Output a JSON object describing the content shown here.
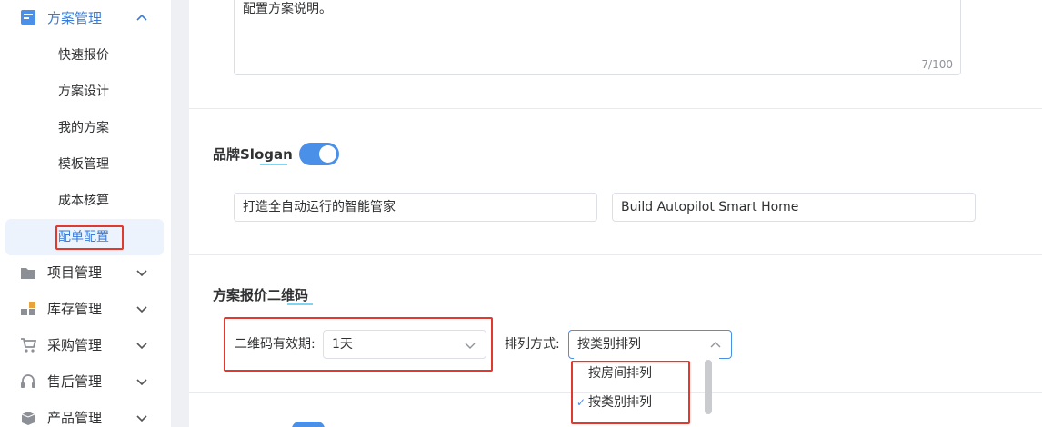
{
  "sidebar": {
    "groups": [
      {
        "label": "方案管理",
        "icon": "document-icon",
        "expanded": true
      },
      {
        "label": "项目管理",
        "icon": "folder-icon"
      },
      {
        "label": "库存管理",
        "icon": "blocks-icon"
      },
      {
        "label": "采购管理",
        "icon": "cart-icon"
      },
      {
        "label": "售后管理",
        "icon": "headset-icon"
      },
      {
        "label": "产品管理",
        "icon": "box-icon"
      }
    ],
    "sub_items": [
      "快速报价",
      "方案设计",
      "我的方案",
      "模板管理",
      "成本核算",
      "配单配置"
    ],
    "active_sub": "配单配置"
  },
  "description": {
    "value": "配置方案说明。",
    "count": "7/100"
  },
  "slogan": {
    "title": "品牌Slogan",
    "enabled": true,
    "cn_value": "打造全自动运行的智能管家",
    "en_value": "Build Autopilot Smart Home"
  },
  "qrcode": {
    "title": "方案报价二维码",
    "validity_label": "二维码有效期:",
    "validity_value": "1天",
    "sort_label": "排列方式:",
    "sort_value": "按类别排列",
    "sort_options": [
      "按房间排列",
      "按类别排列"
    ],
    "selected_option": "按类别排列"
  },
  "colors": {
    "accent": "#4a8fe8",
    "highlight_box": "#e0392f"
  }
}
